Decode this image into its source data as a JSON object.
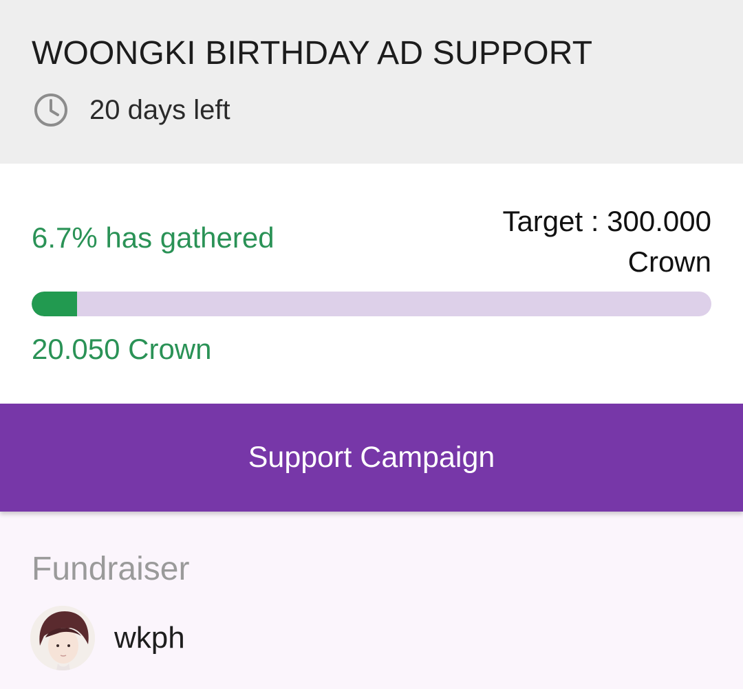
{
  "campaign": {
    "title": "WOONGKI BIRTHDAY AD SUPPORT",
    "days_left": "20 days left",
    "clock_icon": "clock-icon"
  },
  "progress": {
    "percent_label": "6.7% has gathered",
    "target_label": "Target : 300.000 Crown",
    "raised_label": "20.050 Crown",
    "fraction": 0.067,
    "colors": {
      "fill": "#229a50",
      "track": "#ddd0e9",
      "text": "#2a9256"
    }
  },
  "actions": {
    "support_label": "Support Campaign",
    "button_color": "#7737a8"
  },
  "fundraiser": {
    "heading": "Fundraiser",
    "name": "wkph",
    "avatar_icon": "avatar"
  }
}
